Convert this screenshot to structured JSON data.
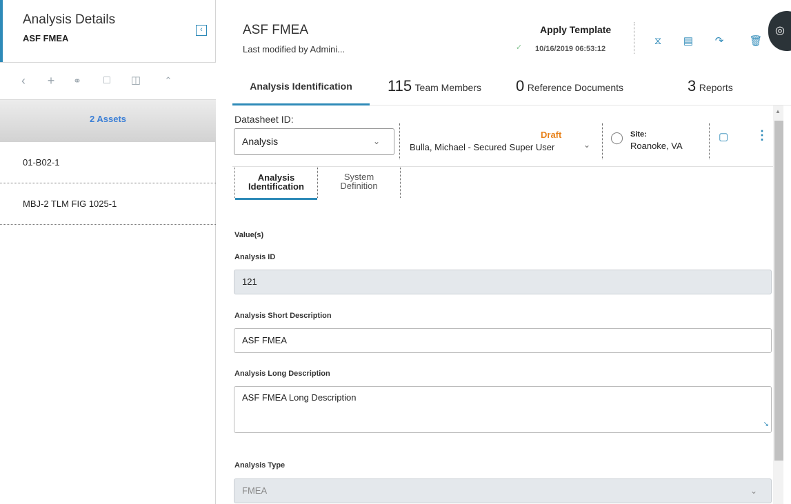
{
  "left": {
    "title": "Analysis Details",
    "subtitle": "ASF FMEA",
    "toolbar": [
      "back-icon",
      "add-icon",
      "find-icon",
      "copy-icon",
      "paste-icon",
      "collapse-up-icon"
    ],
    "assets_header": "2 Assets",
    "assets": [
      "01-B02-1",
      "MBJ-2 TLM FIG 1025-1"
    ]
  },
  "header": {
    "title": "ASF FMEA",
    "modified": "Last modified by Admini...",
    "apply_template": "Apply Template",
    "date": "10/16/2019 06:53:12",
    "icons": [
      "sandglass-icon",
      "report-icon",
      "export-icon",
      "delete-icon"
    ]
  },
  "tabs": [
    {
      "num": "",
      "label": "Analysis Identification"
    },
    {
      "num": "115",
      "label": "Team Members"
    },
    {
      "num": "0",
      "label": "Reference Documents"
    },
    {
      "num": "3",
      "label": "Reports"
    }
  ],
  "datasheet": {
    "label": "Datasheet ID:",
    "value": "Analysis",
    "state": "Draft",
    "owner": "Bulla, Michael - Secured Super User",
    "site_label": "Site:",
    "site_value": "Roanoke, VA"
  },
  "subtabs": [
    {
      "line1": "Analysis",
      "line2": "Identification"
    },
    {
      "line1": "System",
      "line2": "Definition"
    }
  ],
  "form": {
    "values_label": "Value(s)",
    "analysis_id_label": "Analysis ID",
    "analysis_id": "121",
    "short_desc_label": "Analysis Short Description",
    "short_desc": "ASF FMEA",
    "long_desc_label": "Analysis Long Description",
    "long_desc": "ASF FMEA Long Description",
    "type_label": "Analysis Type",
    "type_value": "FMEA"
  },
  "colors": {
    "accent": "#2e8ab8",
    "draft": "#e8821a",
    "assets_link": "#3b7fd6"
  }
}
